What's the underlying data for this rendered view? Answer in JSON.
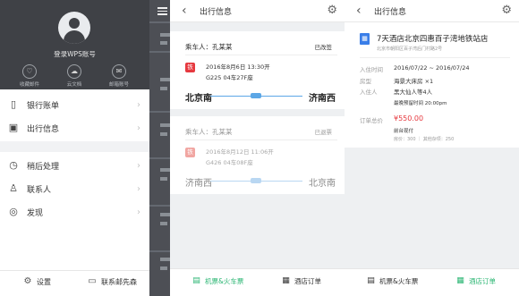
{
  "drawer": {
    "account": "登录WPS账号",
    "quick": [
      {
        "label": "收藏邮件",
        "icon": "heart-icon"
      },
      {
        "label": "云文档",
        "icon": "cloud-icon"
      },
      {
        "label": "邮箱账号",
        "icon": "mail-icon"
      }
    ],
    "menu": [
      {
        "label": "银行账单",
        "icon": "bill-icon"
      },
      {
        "label": "出行信息",
        "icon": "luggage-icon"
      },
      {
        "label": "稍后处理",
        "icon": "clock-icon"
      },
      {
        "label": "联系人",
        "icon": "person-icon"
      },
      {
        "label": "发现",
        "icon": "compass-icon"
      }
    ],
    "footer": {
      "settings": "设置",
      "contact": "联系邮先森"
    }
  },
  "travel": {
    "title": "出行信息",
    "tabs": {
      "flight": "机票&火车票",
      "hotel": "酒店订单"
    },
    "trips": [
      {
        "passenger": "乘车人：孔某某",
        "status": "已改签",
        "datetime": "2016年8月6日  13:30开",
        "train": "G225  04车27F座",
        "from": "北京南",
        "to": "济南西",
        "active": true
      },
      {
        "passenger": "乘车人：孔某某",
        "status": "已退票",
        "datetime": "2016年8月12日  11:06开",
        "train": "G426  04车08F座",
        "from": "济南西",
        "to": "北京南",
        "active": false
      }
    ]
  },
  "hotel": {
    "title": "出行信息",
    "name": "7天酒店北京四惠百子湾地铁站店",
    "address": "北京市朝阳区百子湾后门村路2号",
    "stay_label": "入住时间",
    "stay": "2016/07/22 ~ 2016/07/24",
    "room_label": "房型",
    "room": "海景大床房 ×1",
    "guest_label": "入住人",
    "guest": "黑大仙人等4人",
    "hold": "最晚预留时间  20:00pm",
    "total_label": "订单总价",
    "total": "¥550.00",
    "pay": "前台现付",
    "breakdown": "房价：300  ｜  其他杂项：250",
    "tabs": {
      "flight": "机票&火车票",
      "hotel": "酒店订单"
    }
  },
  "colors": {
    "green": "#2bb673",
    "red": "#e6393f",
    "blue": "#5ca7e6",
    "dark": "#3f4146"
  }
}
